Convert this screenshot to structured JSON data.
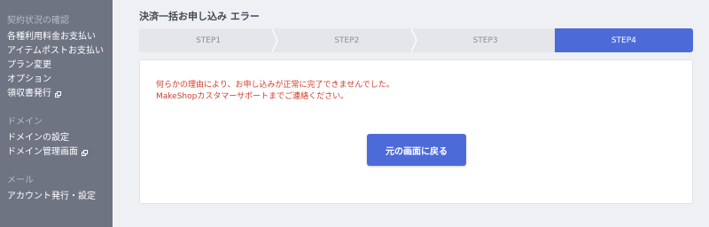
{
  "sidebar": {
    "sections": [
      {
        "heading": "契約状況の確認",
        "items": [
          {
            "label": "各種利用料金お支払い",
            "external": false
          },
          {
            "label": "アイテムポストお支払い",
            "external": false
          },
          {
            "label": "プラン変更",
            "external": false
          },
          {
            "label": "オプション",
            "external": false
          },
          {
            "label": "領収書発行",
            "external": true
          }
        ]
      },
      {
        "heading": "ドメイン",
        "items": [
          {
            "label": "ドメインの設定",
            "external": false
          },
          {
            "label": "ドメイン管理画面",
            "external": true
          }
        ]
      },
      {
        "heading": "メール",
        "items": [
          {
            "label": "アカウント発行・設定",
            "external": false
          }
        ]
      }
    ]
  },
  "main": {
    "title": "決済一括お申し込み エラー",
    "steps": [
      "STEP1",
      "STEP2",
      "STEP3",
      "STEP4"
    ],
    "active_step": 4,
    "error_lines": [
      "何らかの理由により、お申し込みが正常に完了できませんでした。",
      "MakeShopカスタマーサポートまでご連絡ください。"
    ],
    "back_button": "元の画面に戻る"
  },
  "colors": {
    "sidebar_bg": "#6f7483",
    "accent": "#4d6bd8",
    "error_text": "#d23a2a",
    "step_inactive": "#e4e6ea"
  }
}
